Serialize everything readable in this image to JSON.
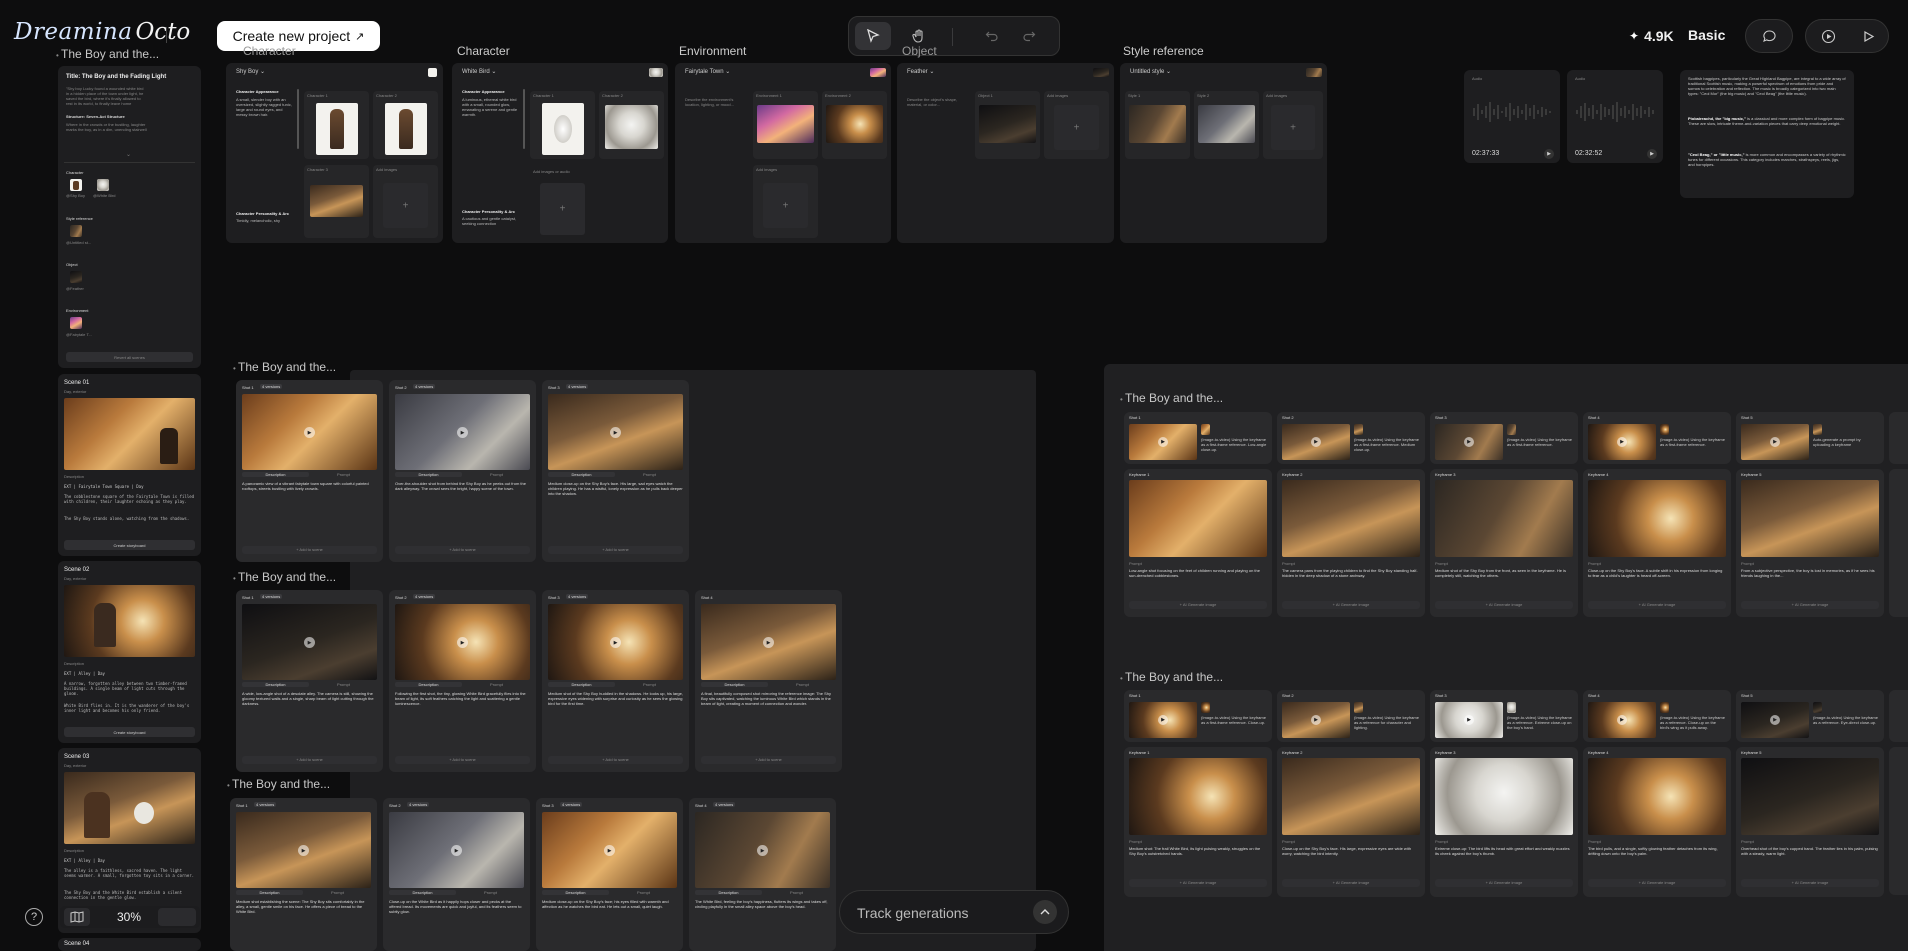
{
  "app": {
    "logo": "Dreamina",
    "logo_suffix": "Octo",
    "create_button": "Create new project",
    "credits": "4.9K",
    "plan": "Basic"
  },
  "sidebar": {
    "project_title": "The Boy and the...",
    "story_title": "Title: The Boy and the Fading Light",
    "story_lines": [
      "\"Shy boy Lucky found a wounded white bird",
      "in a hidden place of the town under light, he",
      "saved the bird, where it's finally allowed to",
      "rest in its world, to finally leave home"
    ],
    "structure_label": "Structure: Seven-Act Structure",
    "structure_lines": [
      "Where in the crowds or the bustling, laughter",
      "marks the boy, as in a dim, unending stairwell"
    ],
    "character_label": "Character",
    "characters": [
      "@Shy Boy",
      "@White Bird"
    ],
    "style_label": "Style reference",
    "style_item": "@Untitled st...",
    "object_label": "Object",
    "object_item": "@Feather",
    "environment_label": "Environment",
    "environment_item": "@Fairytale T...",
    "revert_label": "Revert all scenes",
    "scenes": [
      {
        "title": "Scene 01",
        "sub": "Day, exterior",
        "desc_label": "Description",
        "line1": "EXT | Fairytale Town Square | Day",
        "body": "The cobblestone square of the Fairytale Town is filled with children, their laughter echoing as they play.",
        "body2": "The Shy Boy stands alone, watching from the shadows.",
        "button": "Create storyboard"
      },
      {
        "title": "Scene 02",
        "sub": "Day, exterior",
        "desc_label": "Description",
        "line1": "EXT | Alley | Day",
        "body": "A narrow, forgotten alley between two timber-framed buildings. A single beam of light cuts through the gloom.",
        "body2": "White Bird flies in. It is the wanderer of the boy's inner light and becomes his only friend.",
        "button": "Create storyboard"
      },
      {
        "title": "Scene 03",
        "sub": "Day, exterior",
        "desc_label": "Description",
        "line1": "EXT | Alley | Day",
        "body": "The alley is a faithless, sacred haven. The light seems warmer. A small, forgotten toy sits in a corner.",
        "body2": "The Shy Boy and the White Bird establish a silent connection in the gentle glow.",
        "button": "Create storyboard"
      }
    ],
    "scene04_title": "Scene 04",
    "zoom": "30%"
  },
  "assets": {
    "character_title": "Character",
    "environment_title": "Environment",
    "object_title": "Object",
    "style_title": "Style reference",
    "char1_name": "Shy Boy",
    "char1_h1": "Character Appearance",
    "char1_text": "A small, slender boy with an oversized, slightly ragged tunic, large and round eyes, and messy brown hair.",
    "char1_h2": "Character Personality & Arc",
    "char1_text2": "Timidly, melancholic, shy",
    "char2_name": "White Bird",
    "char2_h1": "Character Appearance",
    "char2_text": "A luminous, ethereal white bird with a small, rounded glow, emanating a serene and gentle warmth.",
    "char2_h2": "Character Personality & Arc",
    "char2_text2": "A cautious and gentle catalyst, seeking connection",
    "env_name": "Fairytale Town",
    "env_text": "Describe the environment's location, lighting, or mood...",
    "obj_name": "Feather",
    "obj_text": "Describe the object's shape, material, or color...",
    "style_name": "Untitled style",
    "labels": {
      "character1": "Character 1",
      "character2": "Character 2",
      "character3": "Character 3",
      "environment1": "Environment 1",
      "environment2": "Environment 2",
      "object1": "Object 1",
      "style1": "Style 1",
      "style2": "Style 2",
      "add_images": "Add images",
      "add_images_audio": "Add images or audio"
    }
  },
  "audio": {
    "clips": [
      {
        "label": "Audio",
        "time": "02:37:33"
      },
      {
        "label": "Audio",
        "time": "02:32:52"
      }
    ]
  },
  "note": {
    "p1": "Scottish bagpipes, particularly the Great Highland Bagpipe, are integral to a wide array of traditional Scottish music, making a powerful spectrum of emotions from pride and sorrow to celebration and reflection. The music is broadly categorized into two main types: \"Ceol Mor\" (the big music) and \"Ceol Beag\" (the little music).",
    "p2_bold": "Piobaireachd, the \"big music,\"",
    "p2": " is a classical and more complex form of bagpipe music. These are slow, intricate theme-and-variation pieces that carry deep emotional weight.",
    "p3_bold": "\"Ceol Beag,\" or \"little music,\"",
    "p3": " is more common and encompasses a variety of rhythmic tunes for different occasions. This category includes marches, strathspeys, reels, jigs, and hornpipes."
  },
  "storyboards": [
    {
      "title": "The Boy and the...",
      "shots": [
        {
          "label": "Shot 1",
          "badge": "4 versions",
          "text": "A panoramic view of a vibrant fairytale town square with colorful painted rooftops, streets bustling with lively crowds."
        },
        {
          "label": "Shot 2",
          "badge": "4 versions",
          "text": "Over-the-shoulder shot from behind the Shy Boy as he peeks out from the dark alleyway. The crowd sees the bright, happy scene of the town."
        },
        {
          "label": "Shot 3",
          "badge": "4 versions",
          "text": "Medium close-up on the Shy Boy's face. His large, sad eyes watch the children playing. He has a wistful, lonely expression as he pulls back deeper into the shadow."
        }
      ]
    },
    {
      "title": "The Boy and the...",
      "shots": [
        {
          "label": "Shot 1",
          "badge": "4 versions",
          "text": "A wide, low-angle shot of a desolate alley. The camera is still, showing the gloomy textured walls and a single, sharp beam of light cutting through the darkness."
        },
        {
          "label": "Shot 2",
          "badge": "4 versions",
          "text": "Following the first shot, the tiny, glowing White Bird gracefully flies into the beam of light, its soft feathers catching the light and scattering a gentle luminescence."
        },
        {
          "label": "Shot 3",
          "badge": "4 versions",
          "text": "Medium shot of the Shy Boy huddled in the shadows. He looks up, his large, expressive eyes widening with surprise and curiosity as he sees the glowing bird for the first time."
        },
        {
          "label": "Shot 4",
          "badge": "",
          "text": "A final, beautifully composed shot mirroring the reference image: The Shy Boy sits captivated, watching the luminous White Bird which stands in the beam of light, creating a moment of connection and wonder."
        }
      ]
    },
    {
      "title": "The Boy and the...",
      "shots": [
        {
          "label": "Shot 1",
          "badge": "4 versions",
          "text": "Medium shot establishing the scene: The Shy Boy sits comfortably in the alley, a small, gentle smile on his face. He offers a piece of bread to the White Bird."
        },
        {
          "label": "Shot 2",
          "badge": "4 versions",
          "text": "Close-up on the White Bird as it happily hops closer and pecks at the offered bread. Its movements are quick and joyful, and its feathers seem to subtly glow."
        },
        {
          "label": "Shot 3",
          "badge": "4 versions",
          "text": "Medium close-up on the Shy Boy's face; his eyes filled with warmth and affection as he watches the bird eat. He lets out a small, quiet laugh."
        },
        {
          "label": "Shot 4",
          "badge": "4 versions",
          "text": "The White Bird, feeling the boy's happiness, flutters its wings and takes off, circling playfully in the small alley space above the boy's head."
        }
      ]
    }
  ],
  "storyboard_labels": {
    "description": "Description",
    "prompt": "Prompt",
    "add": "+ Add to scene",
    "keyframe": "Keyframe",
    "generate": "+ AI Generate image"
  },
  "right_groups": [
    {
      "title": "The Boy and the...",
      "shots": [
        {
          "label": "Shot 1",
          "kf": "Keyframe 1",
          "meta": "(Image-to-video) Using the keyframe as a first-frame reference. Low-angle close-up.",
          "text": "Low-angle shot focusing on the feet of children running and playing on the sun-drenched cobblestones."
        },
        {
          "label": "Shot 2",
          "kf": "Keyframe 2",
          "meta": "(Image-to-video) Using the keyframe as a first-frame reference. Medium close-up.",
          "text": "The camera pans from the playing children to find the Shy Boy standing half-hidden in the deep shadow of a stone archway."
        },
        {
          "label": "Shot 3",
          "kf": "Keyframe 3",
          "meta": "(Image-to-video) Using the keyframe as a first-frame reference.",
          "text": "Medium shot of the Shy Boy from the front, as seen in the keyframe. He is completely still, watching the others."
        },
        {
          "label": "Shot 4",
          "kf": "Keyframe 4",
          "meta": "(Image-to-video) Using the keyframe as a first-frame reference.",
          "text": "Close-up on the Shy Boy's face. A subtle shift in his expression from longing to fear as a child's laughter is heard off-screen."
        },
        {
          "label": "Shot 5",
          "kf": "Keyframe 5",
          "meta": "Auto-generate a prompt by uploading a keyframe",
          "text": "From a subjective perspective, the boy is lost in memories, as if he sees his friends laughing in the..."
        }
      ]
    },
    {
      "title": "The Boy and the...",
      "shots": [
        {
          "label": "Shot 1",
          "kf": "Keyframe 1",
          "meta": "(Image-to-video) Using the keyframe as a first-frame reference. Close-up.",
          "text": "Medium shot: The frail White Bird, its light pulsing weakly, struggles on the Shy Boy's outstretched hands."
        },
        {
          "label": "Shot 2",
          "kf": "Keyframe 2",
          "meta": "(Image-to-video) Using the keyframe as a reference for character and lighting.",
          "text": "Close-up on the Shy Boy's face. His large, expressive eyes are wide with worry, watching the bird intently."
        },
        {
          "label": "Shot 3",
          "kf": "Keyframe 3",
          "meta": "(Image-to-video) Using the keyframe as a reference. Extreme close-up on the boy's hand.",
          "text": "Extreme close-up: The bird lifts its head with great effort and weakly nuzzles its cheek against the boy's thumb."
        },
        {
          "label": "Shot 4",
          "kf": "Keyframe 4",
          "meta": "(Image-to-video) Using the keyframe as a reference. Close-up on the bird's wing as it pulls away.",
          "text": "The bird pulls, and a single, softly glowing feather detaches from its wing, drifting down onto the boy's palm."
        },
        {
          "label": "Shot 5",
          "kf": "Keyframe 5",
          "meta": "(Image-to-video) Using the keyframe as a reference. Eye-direct close-up.",
          "text": "Overhead shot of the boy's cupped hand. The feather lies in his palm, pulsing with a steady, warm light."
        }
      ]
    }
  ],
  "track": {
    "label": "Track generations"
  }
}
